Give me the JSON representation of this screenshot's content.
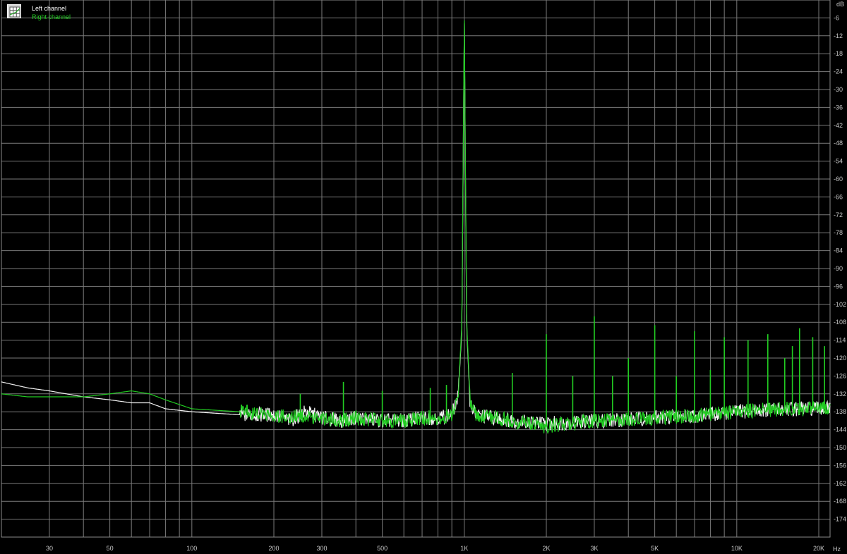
{
  "chart_data": {
    "type": "line",
    "title": "",
    "x_unit": "Hz",
    "y_unit": "dB",
    "x_scale": "log",
    "xlim": [
      20,
      22000
    ],
    "ylim": [
      -180,
      0
    ],
    "grid": true,
    "legend_position": "top-left",
    "x_tick_labels": [
      {
        "value": 30,
        "label": "30"
      },
      {
        "value": 50,
        "label": "50"
      },
      {
        "value": 100,
        "label": "100"
      },
      {
        "value": 200,
        "label": "200"
      },
      {
        "value": 300,
        "label": "300"
      },
      {
        "value": 500,
        "label": "500"
      },
      {
        "value": 1000,
        "label": "1K"
      },
      {
        "value": 2000,
        "label": "2K"
      },
      {
        "value": 3000,
        "label": "3K"
      },
      {
        "value": 5000,
        "label": "5K"
      },
      {
        "value": 10000,
        "label": "10K"
      },
      {
        "value": 20000,
        "label": "20K"
      }
    ],
    "y_ticks": [
      -6,
      -12,
      -18,
      -24,
      -30,
      -36,
      -42,
      -48,
      -54,
      -60,
      -66,
      -72,
      -78,
      -84,
      -90,
      -96,
      -102,
      -108,
      -114,
      -120,
      -126,
      -132,
      -138,
      -144,
      -150,
      -156,
      -162,
      -168,
      -174
    ],
    "series": [
      {
        "name": "Left channel",
        "color": "#ffffff",
        "x": [
          20,
          25,
          30,
          40,
          50,
          60,
          70,
          80,
          100,
          150,
          200,
          230,
          260,
          300,
          350,
          400,
          500,
          600,
          700,
          800,
          900,
          950,
          980,
          1000,
          1020,
          1050,
          1100,
          1300,
          1500,
          2000,
          3000,
          5000,
          8000,
          10000,
          15000,
          20000,
          22000
        ],
        "y": [
          -128,
          -130,
          -131,
          -133,
          -134,
          -135,
          -135,
          -137,
          -138,
          -139,
          -139,
          -141,
          -138,
          -140,
          -141,
          -140,
          -141,
          -141,
          -140,
          -140,
          -139,
          -133,
          -110,
          -6,
          -110,
          -135,
          -139,
          -140,
          -141,
          -142,
          -141,
          -140,
          -139,
          -138,
          -137,
          -137,
          -137
        ]
      },
      {
        "name": "Right channel",
        "color": "#22cc22",
        "x": [
          20,
          25,
          30,
          40,
          50,
          60,
          70,
          80,
          100,
          150,
          200,
          230,
          260,
          300,
          350,
          400,
          500,
          600,
          700,
          800,
          900,
          950,
          980,
          1000,
          1020,
          1050,
          1100,
          1300,
          1500,
          2000,
          3000,
          5000,
          8000,
          10000,
          15000,
          20000,
          22000
        ],
        "y": [
          -132,
          -133,
          -133,
          -133,
          -132,
          -131,
          -132,
          -134,
          -137,
          -138,
          -139,
          -140,
          -139,
          -140,
          -141,
          -140,
          -141,
          -141,
          -140,
          -140,
          -139,
          -132,
          -108,
          -5,
          -108,
          -134,
          -139,
          -140,
          -141,
          -143,
          -141,
          -140,
          -139,
          -138,
          -137,
          -137,
          -137
        ],
        "peaks": [
          {
            "x": 250,
            "y": -132
          },
          {
            "x": 360,
            "y": -128
          },
          {
            "x": 500,
            "y": -131
          },
          {
            "x": 750,
            "y": -130
          },
          {
            "x": 860,
            "y": -129
          },
          {
            "x": 1500,
            "y": -125
          },
          {
            "x": 2000,
            "y": -112
          },
          {
            "x": 2500,
            "y": -126
          },
          {
            "x": 3000,
            "y": -106
          },
          {
            "x": 3500,
            "y": -126
          },
          {
            "x": 4000,
            "y": -120
          },
          {
            "x": 5000,
            "y": -109
          },
          {
            "x": 6000,
            "y": -126
          },
          {
            "x": 7000,
            "y": -111
          },
          {
            "x": 8000,
            "y": -124
          },
          {
            "x": 9000,
            "y": -113
          },
          {
            "x": 11000,
            "y": -114
          },
          {
            "x": 13000,
            "y": -112
          },
          {
            "x": 15000,
            "y": -120
          },
          {
            "x": 16000,
            "y": -116
          },
          {
            "x": 17000,
            "y": -110
          },
          {
            "x": 19000,
            "y": -113
          },
          {
            "x": 21000,
            "y": -116
          }
        ]
      }
    ]
  }
}
